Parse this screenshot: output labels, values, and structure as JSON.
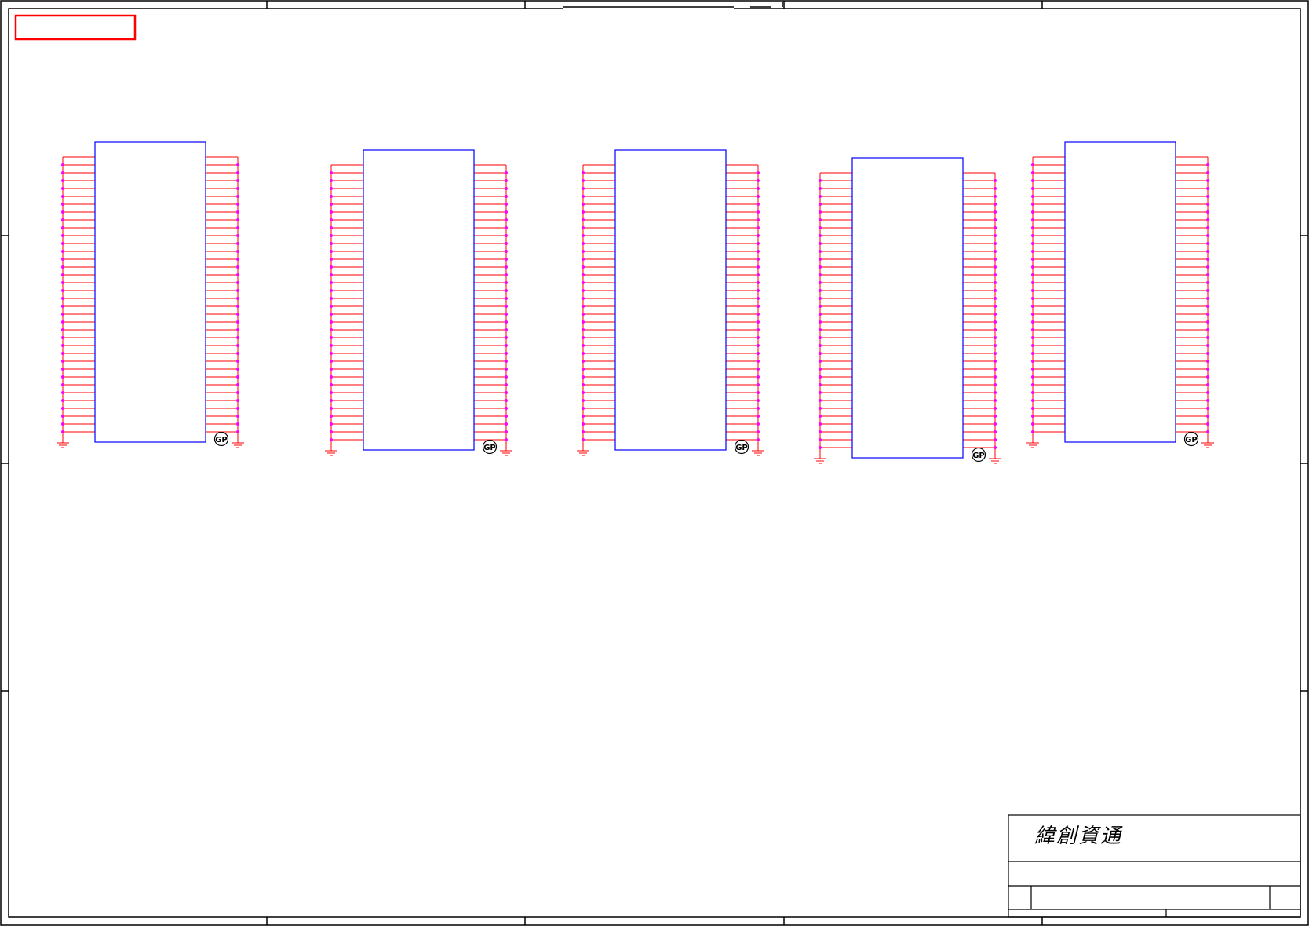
{
  "sheet": {
    "company_name": "緯創資通",
    "colors": {
      "border": "#000000",
      "net": "#ff0000",
      "part": "#0000ff",
      "pin": "#ff00ff",
      "stamp": "#ff0000"
    }
  },
  "ground_badge_text": "GP",
  "connectors": [
    {
      "id": "connector-1",
      "pins_per_side": 36
    },
    {
      "id": "connector-2",
      "pins_per_side": 36
    },
    {
      "id": "connector-3",
      "pins_per_side": 36
    },
    {
      "id": "connector-4",
      "pins_per_side": 36
    },
    {
      "id": "connector-5",
      "pins_per_side": 36
    }
  ]
}
